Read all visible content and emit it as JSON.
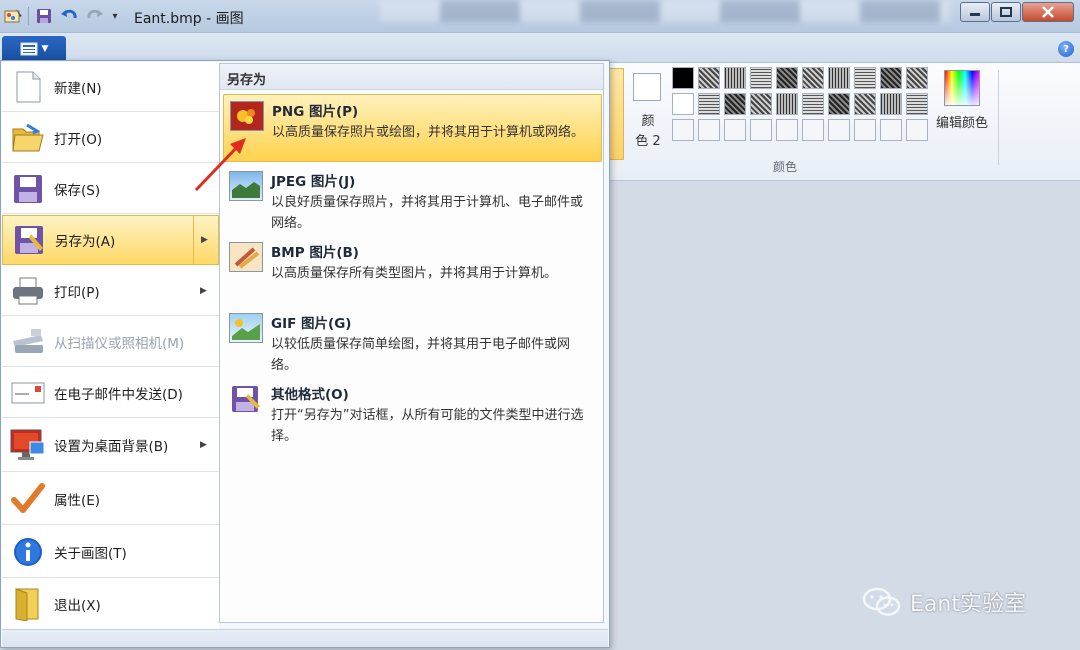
{
  "window": {
    "title": "Eant.bmp - 画图",
    "buttons": {
      "minimize": "minimize",
      "maximize": "maximize",
      "close": "close"
    }
  },
  "quick_access": [
    "save-icon",
    "undo-icon",
    "redo-icon",
    "customize-icon"
  ],
  "ribbon": {
    "color2_label": "颜\n色 2",
    "colors_group_label": "颜色",
    "edit_colors_label": "编辑颜色",
    "accent": "#ffd966"
  },
  "app_menu": {
    "items": [
      {
        "label": "新建(N)",
        "icon": "new-file-icon",
        "enabled": true,
        "submenu": false
      },
      {
        "label": "打开(O)",
        "icon": "open-folder-icon",
        "enabled": true,
        "submenu": false
      },
      {
        "label": "保存(S)",
        "icon": "save-disk-icon",
        "enabled": true,
        "submenu": false
      },
      {
        "label": "另存为(A)",
        "icon": "save-as-icon",
        "enabled": true,
        "submenu": true,
        "selected": true
      },
      {
        "label": "打印(P)",
        "icon": "printer-icon",
        "enabled": true,
        "submenu": true
      },
      {
        "label": "从扫描仪或照相机(M)",
        "icon": "scanner-icon",
        "enabled": false,
        "submenu": false
      },
      {
        "label": "在电子邮件中发送(D)",
        "icon": "email-icon",
        "enabled": true,
        "submenu": false
      },
      {
        "label": "设置为桌面背景(B)",
        "icon": "desktop-background-icon",
        "enabled": true,
        "submenu": true
      },
      {
        "label": "属性(E)",
        "icon": "checkmark-icon",
        "enabled": true,
        "submenu": false
      },
      {
        "label": "关于画图(T)",
        "icon": "info-icon",
        "enabled": true,
        "submenu": false
      },
      {
        "label": "退出(X)",
        "icon": "exit-icon",
        "enabled": true,
        "submenu": false
      }
    ]
  },
  "save_as_menu": {
    "title": "另存为",
    "items": [
      {
        "title": "PNG 图片(P)",
        "desc": "以高质量保存照片或绘图，并将其用于计算机或网络。",
        "icon": "png-image-icon",
        "highlighted": true
      },
      {
        "title": "JPEG 图片(J)",
        "desc": "以良好质量保存照片，并将其用于计算机、电子邮件或网络。",
        "icon": "jpeg-image-icon"
      },
      {
        "title": "BMP 图片(B)",
        "desc": "以高质量保存所有类型图片，并将其用于计算机。",
        "icon": "bmp-image-icon"
      },
      {
        "title": "GIF 图片(G)",
        "desc": "以较低质量保存简单绘图，并将其用于电子邮件或网络。",
        "icon": "gif-image-icon"
      },
      {
        "title": "其他格式(O)",
        "desc": "打开“另存为”对话框，从所有可能的文件类型中进行选择。",
        "icon": "other-formats-icon"
      }
    ]
  },
  "watermark": {
    "text": "Eant实验室",
    "icon": "wechat-icon"
  }
}
